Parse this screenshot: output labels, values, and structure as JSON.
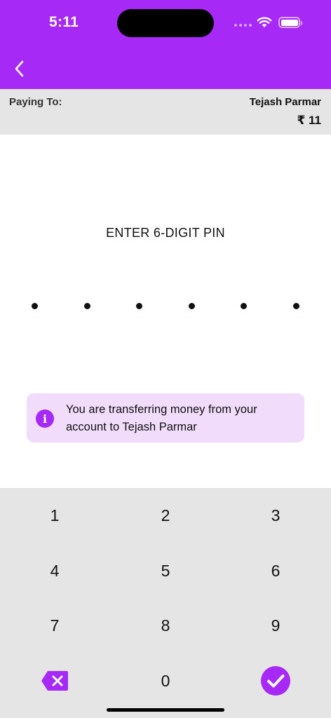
{
  "status_bar": {
    "time": "5:11"
  },
  "header": {
    "back_icon": "chevron-left-icon"
  },
  "payment": {
    "paying_to_label": "Paying To:",
    "payee_name": "Tejash Parmar",
    "amount": "₹ 11"
  },
  "pin": {
    "title": "ENTER 6-DIGIT PIN",
    "digits_total": 6,
    "digits_entered": 6
  },
  "info": {
    "icon": "info-icon",
    "message": "You are transferring money from your account to Tejash Parmar"
  },
  "keypad": {
    "keys": [
      "1",
      "2",
      "3",
      "4",
      "5",
      "6",
      "7",
      "8",
      "9"
    ],
    "zero": "0",
    "backspace_icon": "backspace-icon",
    "submit_icon": "checkmark-icon"
  },
  "colors": {
    "accent": "#a729f5",
    "bar_gray": "#e5e5e5",
    "info_bg": "#f1dcfc"
  }
}
